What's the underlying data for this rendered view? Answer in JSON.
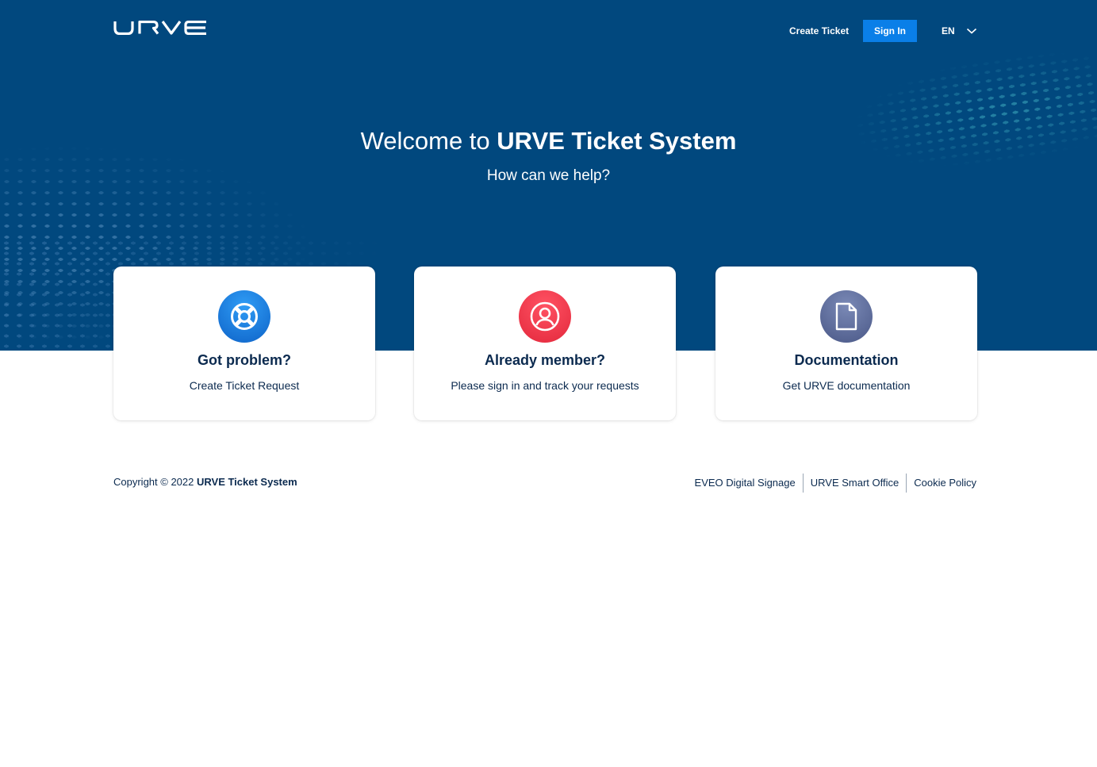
{
  "header": {
    "logo_text": "URVE",
    "create_ticket_label": "Create Ticket",
    "sign_in_label": "Sign In",
    "language": "EN"
  },
  "hero": {
    "title_prefix": "Welcome to",
    "title_brand": "URVE Ticket System",
    "subtitle": "How can we help?"
  },
  "cards": [
    {
      "title": "Got problem?",
      "description": "Create Ticket Request",
      "icon": "lifebuoy-icon",
      "color": "#1a7de0"
    },
    {
      "title": "Already member?",
      "description": "Please sign in and track your requests",
      "icon": "user-icon",
      "color": "#f2384a"
    },
    {
      "title": "Documentation",
      "description": "Get URVE documentation",
      "icon": "document-icon",
      "color": "#5d6c98"
    }
  ],
  "footer": {
    "copyright_prefix": "Copyright © 2022",
    "copyright_brand": "URVE Ticket System",
    "links": [
      "EVEO Digital Signage",
      "URVE Smart Office",
      "Cookie Policy"
    ]
  },
  "colors": {
    "hero_bg": "#01487e",
    "sign_in_bg": "#0a7fe8",
    "text_dark": "#0b2a4f"
  }
}
